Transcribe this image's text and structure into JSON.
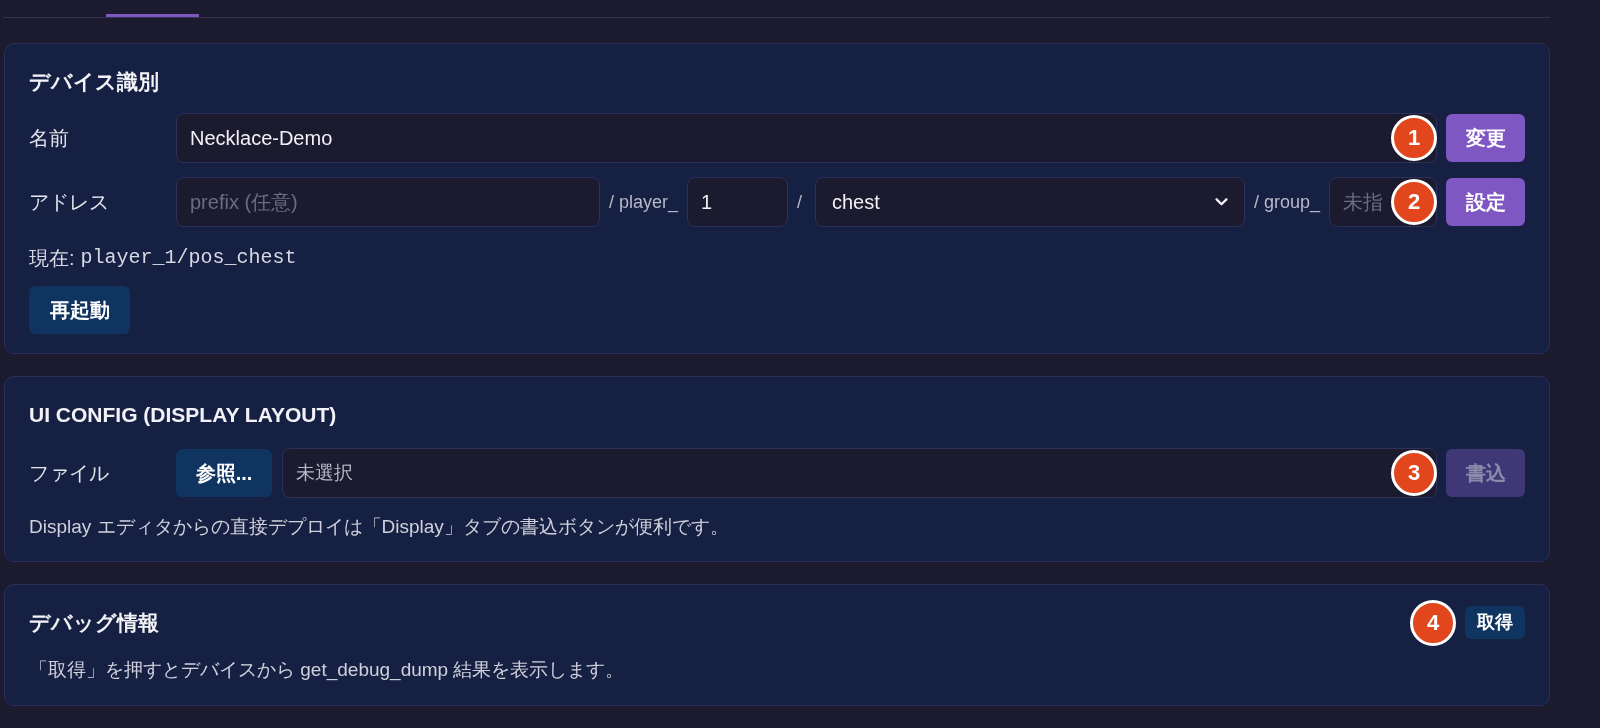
{
  "device_identity": {
    "title": "デバイス識別",
    "name_row": {
      "label": "名前",
      "input": {
        "value": "Necklace-Demo"
      },
      "marker": "1",
      "button": {
        "label": "変更",
        "disabled": false
      }
    },
    "address_row": {
      "label": "アドレス",
      "prefix_input": {
        "placeholder": "prefix (任意)"
      },
      "player_separator": "/ player_",
      "player_input": {
        "value": "1"
      },
      "position_separator": "/",
      "position_select": {
        "value": "chest"
      },
      "group_separator": "/ group_",
      "group_input": {
        "placeholder": "未指"
      },
      "marker": "2",
      "button": {
        "label": "設定",
        "disabled": false
      }
    },
    "current_address": {
      "label": "現在:",
      "value": "player_1/pos_chest"
    },
    "restart_button": {
      "label": "再起動"
    }
  },
  "ui_config": {
    "title": "UI CONFIG (DISPLAY LAYOUT)",
    "file_row": {
      "label": "ファイル",
      "browse_button": {
        "label": "参照..."
      },
      "file_field": {
        "value": "未選択"
      },
      "marker": "3",
      "button": {
        "label": "書込",
        "disabled": true
      }
    },
    "note": "Display エディタからの直接デプロイは「Display」タブの書込ボタンが便利です。"
  },
  "debug_info": {
    "title": "デバッグ情報",
    "marker": "4",
    "fetch_button": {
      "label": "取得"
    },
    "note": "「取得」を押すとデバイスから get_debug_dump 結果を表示します。"
  }
}
